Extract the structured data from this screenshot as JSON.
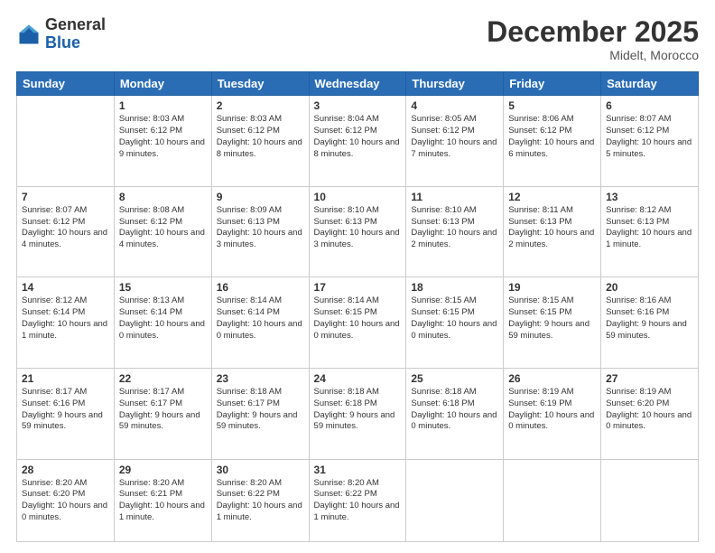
{
  "header": {
    "logo": {
      "general": "General",
      "blue": "Blue"
    },
    "title": "December 2025",
    "subtitle": "Midelt, Morocco"
  },
  "calendar": {
    "weekdays": [
      "Sunday",
      "Monday",
      "Tuesday",
      "Wednesday",
      "Thursday",
      "Friday",
      "Saturday"
    ],
    "weeks": [
      [
        {
          "day": "",
          "info": ""
        },
        {
          "day": "1",
          "info": "Sunrise: 8:03 AM\nSunset: 6:12 PM\nDaylight: 10 hours and 9 minutes."
        },
        {
          "day": "2",
          "info": "Sunrise: 8:03 AM\nSunset: 6:12 PM\nDaylight: 10 hours and 8 minutes."
        },
        {
          "day": "3",
          "info": "Sunrise: 8:04 AM\nSunset: 6:12 PM\nDaylight: 10 hours and 8 minutes."
        },
        {
          "day": "4",
          "info": "Sunrise: 8:05 AM\nSunset: 6:12 PM\nDaylight: 10 hours and 7 minutes."
        },
        {
          "day": "5",
          "info": "Sunrise: 8:06 AM\nSunset: 6:12 PM\nDaylight: 10 hours and 6 minutes."
        },
        {
          "day": "6",
          "info": "Sunrise: 8:07 AM\nSunset: 6:12 PM\nDaylight: 10 hours and 5 minutes."
        }
      ],
      [
        {
          "day": "7",
          "info": "Sunrise: 8:07 AM\nSunset: 6:12 PM\nDaylight: 10 hours and 4 minutes."
        },
        {
          "day": "8",
          "info": "Sunrise: 8:08 AM\nSunset: 6:12 PM\nDaylight: 10 hours and 4 minutes."
        },
        {
          "day": "9",
          "info": "Sunrise: 8:09 AM\nSunset: 6:13 PM\nDaylight: 10 hours and 3 minutes."
        },
        {
          "day": "10",
          "info": "Sunrise: 8:10 AM\nSunset: 6:13 PM\nDaylight: 10 hours and 3 minutes."
        },
        {
          "day": "11",
          "info": "Sunrise: 8:10 AM\nSunset: 6:13 PM\nDaylight: 10 hours and 2 minutes."
        },
        {
          "day": "12",
          "info": "Sunrise: 8:11 AM\nSunset: 6:13 PM\nDaylight: 10 hours and 2 minutes."
        },
        {
          "day": "13",
          "info": "Sunrise: 8:12 AM\nSunset: 6:13 PM\nDaylight: 10 hours and 1 minute."
        }
      ],
      [
        {
          "day": "14",
          "info": "Sunrise: 8:12 AM\nSunset: 6:14 PM\nDaylight: 10 hours and 1 minute."
        },
        {
          "day": "15",
          "info": "Sunrise: 8:13 AM\nSunset: 6:14 PM\nDaylight: 10 hours and 0 minutes."
        },
        {
          "day": "16",
          "info": "Sunrise: 8:14 AM\nSunset: 6:14 PM\nDaylight: 10 hours and 0 minutes."
        },
        {
          "day": "17",
          "info": "Sunrise: 8:14 AM\nSunset: 6:15 PM\nDaylight: 10 hours and 0 minutes."
        },
        {
          "day": "18",
          "info": "Sunrise: 8:15 AM\nSunset: 6:15 PM\nDaylight: 10 hours and 0 minutes."
        },
        {
          "day": "19",
          "info": "Sunrise: 8:15 AM\nSunset: 6:15 PM\nDaylight: 9 hours and 59 minutes."
        },
        {
          "day": "20",
          "info": "Sunrise: 8:16 AM\nSunset: 6:16 PM\nDaylight: 9 hours and 59 minutes."
        }
      ],
      [
        {
          "day": "21",
          "info": "Sunrise: 8:17 AM\nSunset: 6:16 PM\nDaylight: 9 hours and 59 minutes."
        },
        {
          "day": "22",
          "info": "Sunrise: 8:17 AM\nSunset: 6:17 PM\nDaylight: 9 hours and 59 minutes."
        },
        {
          "day": "23",
          "info": "Sunrise: 8:18 AM\nSunset: 6:17 PM\nDaylight: 9 hours and 59 minutes."
        },
        {
          "day": "24",
          "info": "Sunrise: 8:18 AM\nSunset: 6:18 PM\nDaylight: 9 hours and 59 minutes."
        },
        {
          "day": "25",
          "info": "Sunrise: 8:18 AM\nSunset: 6:18 PM\nDaylight: 10 hours and 0 minutes."
        },
        {
          "day": "26",
          "info": "Sunrise: 8:19 AM\nSunset: 6:19 PM\nDaylight: 10 hours and 0 minutes."
        },
        {
          "day": "27",
          "info": "Sunrise: 8:19 AM\nSunset: 6:20 PM\nDaylight: 10 hours and 0 minutes."
        }
      ],
      [
        {
          "day": "28",
          "info": "Sunrise: 8:20 AM\nSunset: 6:20 PM\nDaylight: 10 hours and 0 minutes."
        },
        {
          "day": "29",
          "info": "Sunrise: 8:20 AM\nSunset: 6:21 PM\nDaylight: 10 hours and 1 minute."
        },
        {
          "day": "30",
          "info": "Sunrise: 8:20 AM\nSunset: 6:22 PM\nDaylight: 10 hours and 1 minute."
        },
        {
          "day": "31",
          "info": "Sunrise: 8:20 AM\nSunset: 6:22 PM\nDaylight: 10 hours and 1 minute."
        },
        {
          "day": "",
          "info": ""
        },
        {
          "day": "",
          "info": ""
        },
        {
          "day": "",
          "info": ""
        }
      ]
    ]
  }
}
